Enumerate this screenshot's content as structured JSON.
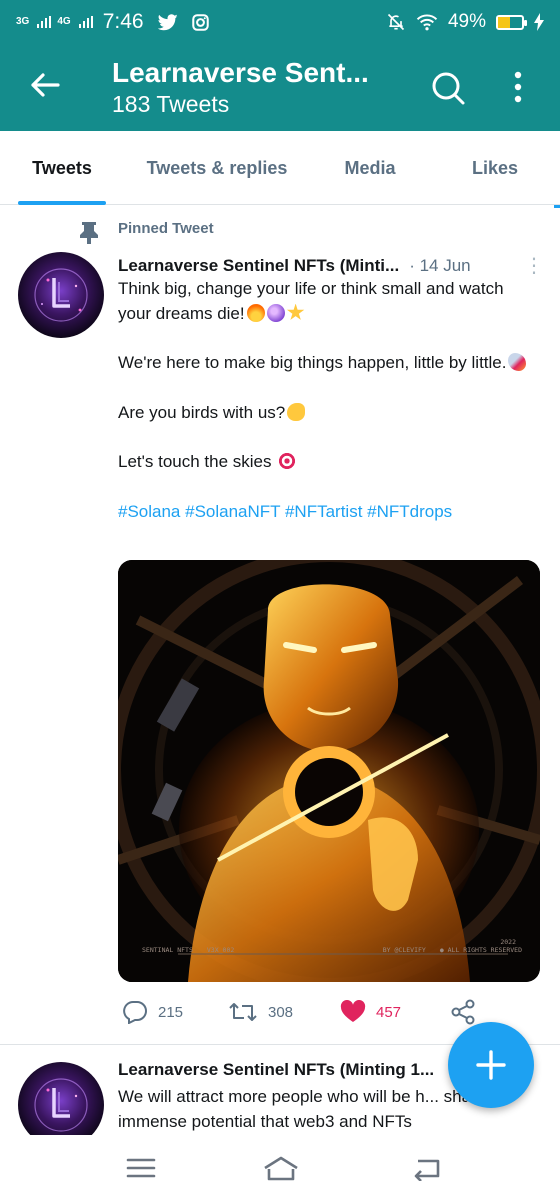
{
  "status_bar": {
    "network_1": "3G",
    "network_2": "4G",
    "time": "7:46",
    "battery_percent": "49%",
    "battery_level": 0.49,
    "icons": [
      "twitter-icon",
      "instagram-icon",
      "mute-icon",
      "wifi-icon",
      "battery-icon",
      "charging-icon"
    ]
  },
  "header": {
    "title": "Learnaverse Sent...",
    "subtitle": "183 Tweets",
    "icons": [
      "back-arrow-icon",
      "search-icon",
      "more-vertical-icon"
    ]
  },
  "tabs": [
    {
      "label": "Tweets",
      "active": true
    },
    {
      "label": "Tweets & replies",
      "active": false
    },
    {
      "label": "Media",
      "active": false
    },
    {
      "label": "Likes",
      "active": false
    }
  ],
  "tweets": [
    {
      "pinned_label": "Pinned Tweet",
      "name": "Learnaverse Sentinel NFTs (Minti...",
      "date": "· 14 Jun",
      "lines": [
        "Think big, change your life or think small and watch your dreams die!",
        "We're here to make big things happen, little by little.",
        "Are you birds with us?",
        "Let's touch the skies"
      ],
      "hashtags": "#Solana #SolanaNFT #NFTartist #NFTdrops",
      "media_caption": {
        "left": "SENTINAL NFTS",
        "code": "V3X_002",
        "by": "BY @CLEVIFY",
        "year": "2022",
        "rights": "● ALL RIGHTS RESERVED"
      },
      "replies": "215",
      "retweets": "308",
      "likes": "457"
    },
    {
      "name": "Learnaverse Sentinel NFTs (Minting 1...",
      "text": "We will attract more people who will be h... share the immense potential that web3 and NFTs"
    }
  ],
  "colors": {
    "header_bg": "#148c8c",
    "accent": "#1da1f2",
    "like": "#e0245e",
    "secondary_text": "#5b7083"
  }
}
